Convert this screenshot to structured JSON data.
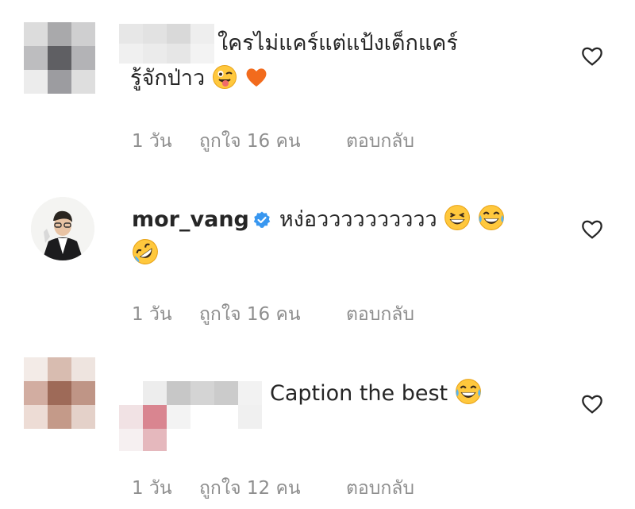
{
  "comments": [
    {
      "username_hidden": true,
      "text_line1": "ใครไม่แคร์แต่แป้งเด็กแคร์",
      "text_line2": "รู้จักป่าว",
      "emojis": [
        "winking-face-with-tongue",
        "orange-heart"
      ],
      "time": "1 วัน",
      "likes": "ถูกใจ 16 คน",
      "reply": "ตอบกลับ"
    },
    {
      "username": "mor_vang",
      "verified": true,
      "text": "หง่อวววววววววว",
      "emojis": [
        "grinning-squinting-face",
        "face-with-tears-of-joy",
        "rolling-on-floor-laughing"
      ],
      "time": "1 วัน",
      "likes": "ถูกใจ 16 คน",
      "reply": "ตอบกลับ"
    },
    {
      "username_hidden": true,
      "text": "Caption the best",
      "emojis": [
        "face-with-tears-of-joy"
      ],
      "time": "1 วัน",
      "likes": "ถูกใจ 12 คน",
      "reply": "ตอบกลับ"
    }
  ],
  "colors": {
    "text": "#262626",
    "meta": "#8e8e8e",
    "verified": "#3897f0",
    "heart_outline": "#262626"
  }
}
